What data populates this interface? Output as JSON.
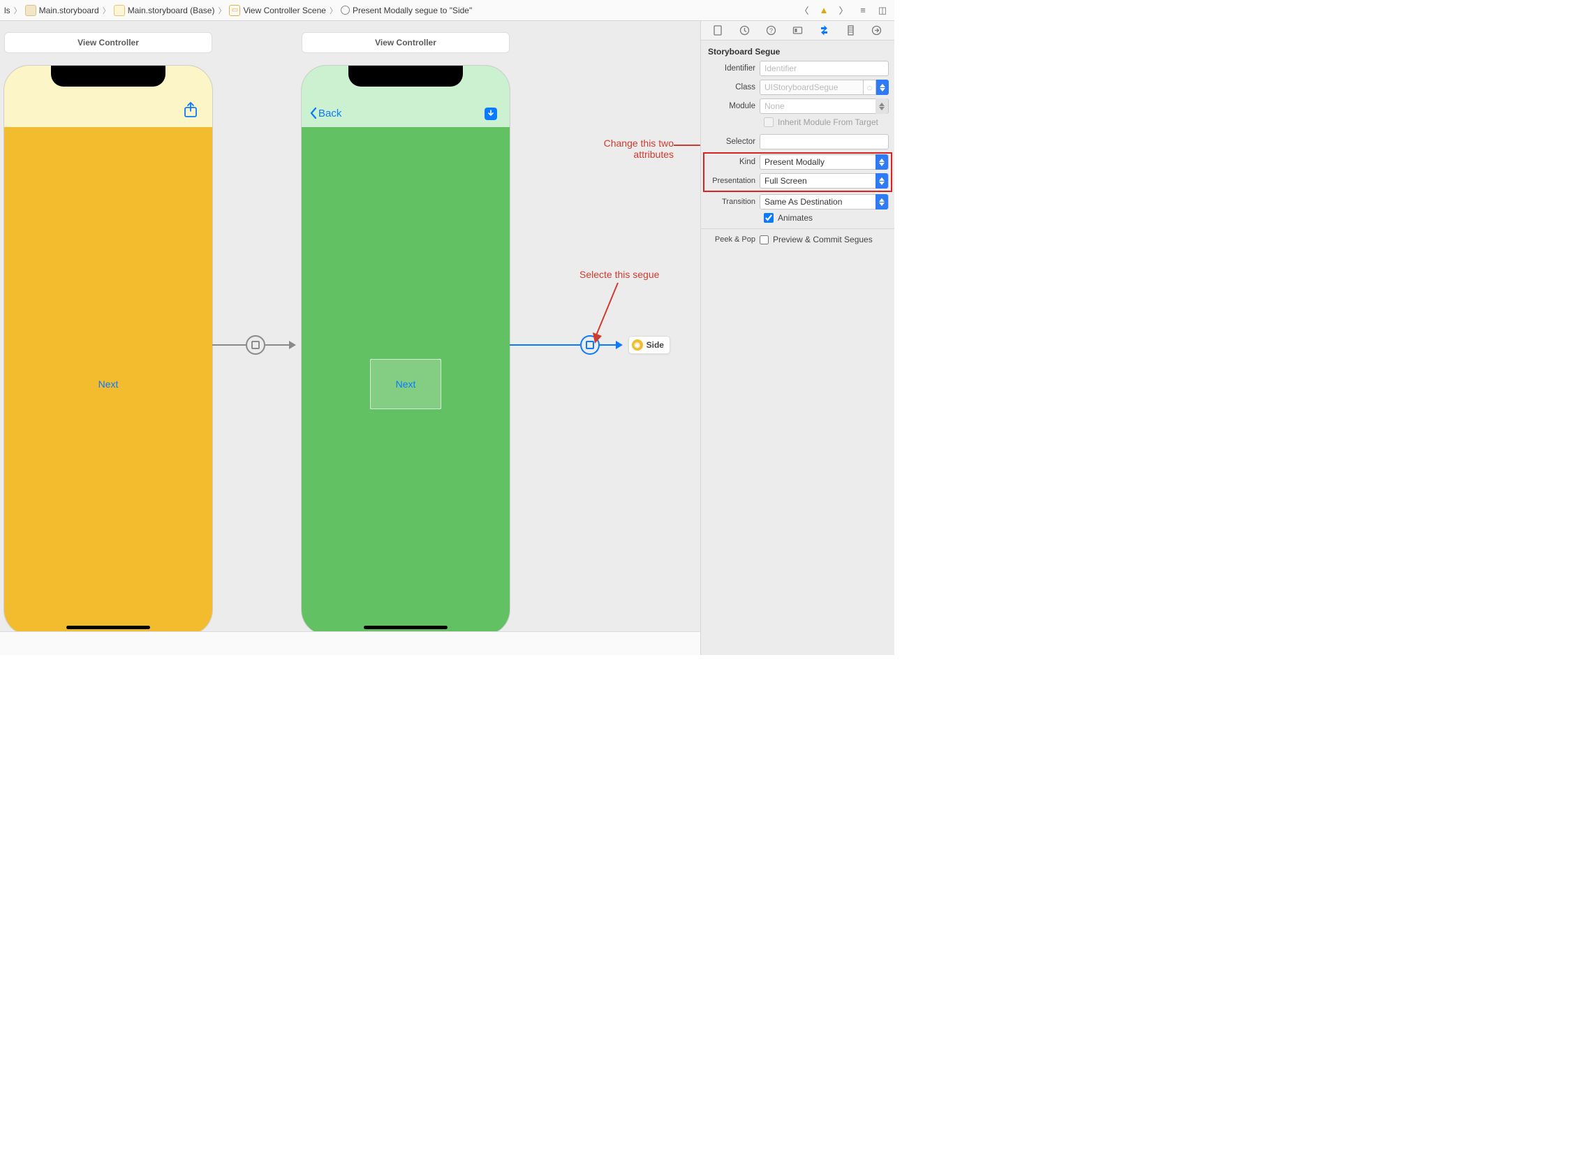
{
  "breadcrumbs": {
    "b0": "ls",
    "b1": "Main.storyboard",
    "b2": "Main.storyboard (Base)",
    "b3": "View Controller Scene",
    "b4": "Present Modally segue to \"Side\""
  },
  "canvas": {
    "vc1_title": "View Controller",
    "vc1_button": "Next",
    "vc2_title": "View Controller",
    "vc2_back": "Back",
    "vc2_button": "Next",
    "side_badge": "Side"
  },
  "annotations": {
    "a1_line1": "Change this two",
    "a1_line2": "attributes",
    "a2": "Selecte this segue"
  },
  "inspector": {
    "header": "Storyboard Segue",
    "identifier_label": "Identifier",
    "identifier_placeholder": "Identifier",
    "class_label": "Class",
    "class_value": "UIStoryboardSegue",
    "module_label": "Module",
    "module_value": "None",
    "inherit_label": "Inherit Module From Target",
    "selector_label": "Selector",
    "kind_label": "Kind",
    "kind_value": "Present Modally",
    "presentation_label": "Presentation",
    "presentation_value": "Full Screen",
    "transition_label": "Transition",
    "transition_value": "Same As Destination",
    "animates_label": "Animates",
    "peekpop_label": "Peek & Pop",
    "preview_label": "Preview & Commit Segues"
  }
}
